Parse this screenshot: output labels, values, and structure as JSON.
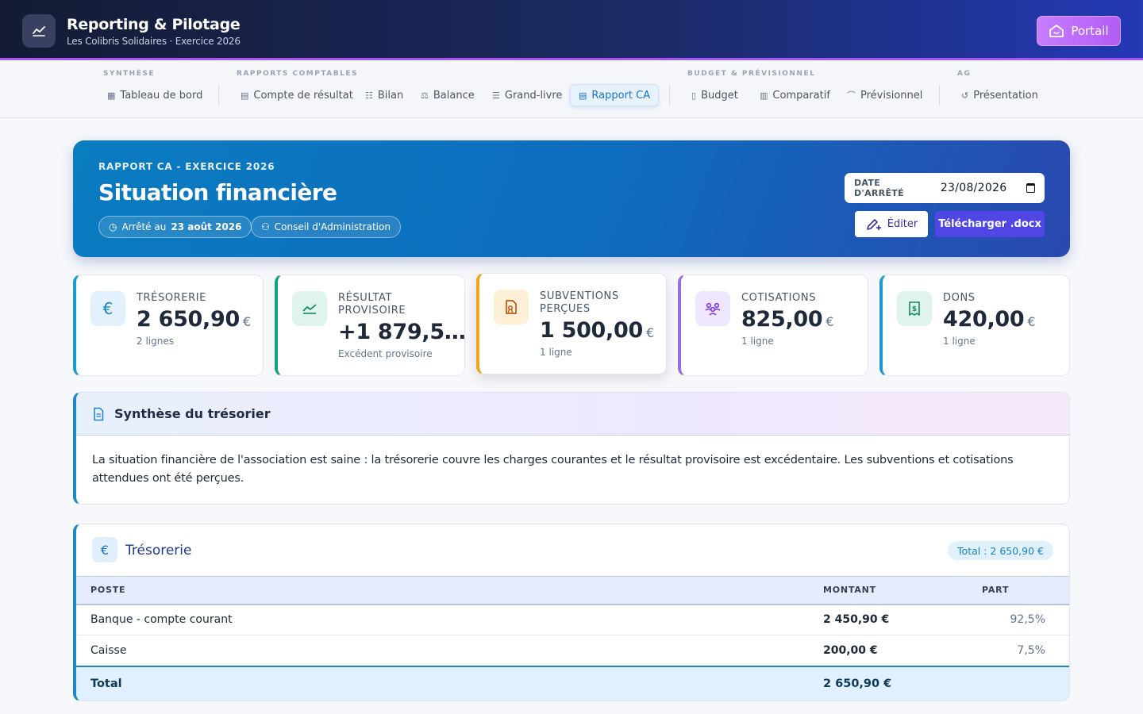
{
  "header": {
    "title": "Reporting & Pilotage",
    "subtitle": "Les Colibris Solidaires · Exercice 2026",
    "portal_label": "Portail"
  },
  "nav": {
    "groups": [
      {
        "label": "SYNTHÈSE"
      },
      {
        "label": "RAPPORTS COMPTABLES"
      },
      {
        "label": "BUDGET & PRÉVISIONNEL"
      },
      {
        "label": "AG"
      }
    ],
    "items": [
      {
        "label": "Tableau de bord",
        "icon": "dashboard-icon"
      },
      {
        "label": "Compte de résultat",
        "icon": "document-icon"
      },
      {
        "label": "Bilan",
        "icon": "columns-icon"
      },
      {
        "label": "Balance",
        "icon": "scale-icon"
      },
      {
        "label": "Grand-livre",
        "icon": "list-icon"
      },
      {
        "label": "Rapport CA",
        "icon": "report-icon",
        "active": true
      },
      {
        "label": "Budget",
        "icon": "receipt-icon"
      },
      {
        "label": "Comparatif",
        "icon": "bar-chart-icon"
      },
      {
        "label": "Prévisionnel",
        "icon": "trend-icon"
      },
      {
        "label": "Présentation",
        "icon": "history-icon"
      }
    ]
  },
  "hero": {
    "kicker": "RAPPORT CA - EXERCICE 2026",
    "title": "Situation financière",
    "chip_date_prefix": "Arrêté au",
    "chip_date_value": "23 août 2026",
    "chip_board": "Conseil d'Administration",
    "date_label": "DATE D'ARRÊTÉ",
    "date_value": "23/08/2026",
    "edit_label": "Éditer",
    "download_label": "Télécharger .docx"
  },
  "kpis": [
    {
      "label": "TRÉSORERIE",
      "value": "2 650,90",
      "currency": "€",
      "sub": "2 lignes",
      "color": "#1a9bd4",
      "icon_bg": "#e2f1fb",
      "icon_color": "#1a82c8",
      "icon": "euro-icon"
    },
    {
      "label": "RÉSULTAT PROVISOIRE",
      "value": "+1 879,5…",
      "currency": "",
      "sub": "Excédent provisoire",
      "color": "#10a37f",
      "icon_bg": "#dff5ec",
      "icon_color": "#0f8a63",
      "icon": "trend-up-icon"
    },
    {
      "label": "SUBVENTIONS PERÇUES",
      "value": "1 500,00",
      "currency": "€",
      "sub": "1 ligne",
      "color": "#f0a21a",
      "icon_bg": "#fdf0d7",
      "icon_color": "#c2570c",
      "icon": "grant-document-icon"
    },
    {
      "label": "COTISATIONS",
      "value": "825,00",
      "currency": "€",
      "sub": "1 ligne",
      "color": "#9b6ee8",
      "icon_bg": "#efe7fd",
      "icon_color": "#7c3aed",
      "icon": "members-icon"
    },
    {
      "label": "DONS",
      "value": "420,00",
      "currency": "€",
      "sub": "1 ligne",
      "color": "#1a9bd4",
      "icon_bg": "#dff5ec",
      "icon_color": "#0f8a63",
      "icon": "donation-receipt-icon"
    }
  ],
  "synthesis": {
    "title": "Synthèse du trésorier",
    "text": "La situation financière de l'association est saine : la trésorerie couvre les charges courantes et le résultat provisoire est excédentaire. Les subventions et cotisations attendues ont été perçues."
  },
  "treasury": {
    "title": "Trésorerie",
    "total_badge": "Total : 2 650,90 €",
    "columns": [
      "POSTE",
      "MONTANT",
      "PART"
    ],
    "rows": [
      {
        "poste": "Banque - compte courant",
        "montant": "2 450,90 €",
        "part": "92,5%"
      },
      {
        "poste": "Caisse",
        "montant": "200,00 €",
        "part": "7,5%"
      }
    ],
    "total_label": "Total",
    "total_value": "2 650,90 €"
  }
}
